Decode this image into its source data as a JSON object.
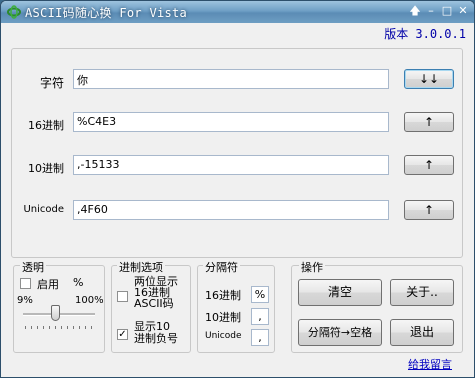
{
  "window": {
    "title": "ASCII码随心换 For Vista",
    "icon": "app-logo-icon",
    "controls": [
      "pin-icon",
      "minimize-icon",
      "maximize-icon",
      "close-icon"
    ]
  },
  "version": "版本 3.0.0.1",
  "rows": [
    {
      "label": "字符",
      "value": "你",
      "button": "↓↓"
    },
    {
      "label": "16进制",
      "value": "%C4E3",
      "button": "↑"
    },
    {
      "label": "10进制",
      "value": ",-15133",
      "button": "↑"
    },
    {
      "label": "Unicode",
      "value": ",4F60",
      "button": "↑"
    }
  ],
  "transparency": {
    "title": "透明",
    "enable_label": "启用",
    "percent_symbol": "%",
    "min_label": "9%",
    "max_label": "100%",
    "enabled": false
  },
  "base_options": {
    "title": "进制选项",
    "option1_label": "两位显示16进制ASCII码",
    "option1_line1": "两位显示",
    "option1_line2": "16进制",
    "option1_line3": "ASCII码",
    "option1_checked": false,
    "option2_line1": "显示10",
    "option2_line2": "进制负号",
    "option2_checked": true
  },
  "separator": {
    "title": "分隔符",
    "hex_label": "16进制",
    "hex_value": "%",
    "dec_label": "10进制",
    "dec_value": ",",
    "unicode_label": "Unicode",
    "unicode_value": ","
  },
  "operations": {
    "title": "操作",
    "clear": "清空",
    "about": "关于..",
    "sep_to_space": "分隔符→空格",
    "exit": "退出"
  },
  "feedback_link": "给我留言",
  "colors": {
    "title_bar": "#6f9fc5",
    "link": "#0000c0",
    "version": "#0000a8"
  }
}
